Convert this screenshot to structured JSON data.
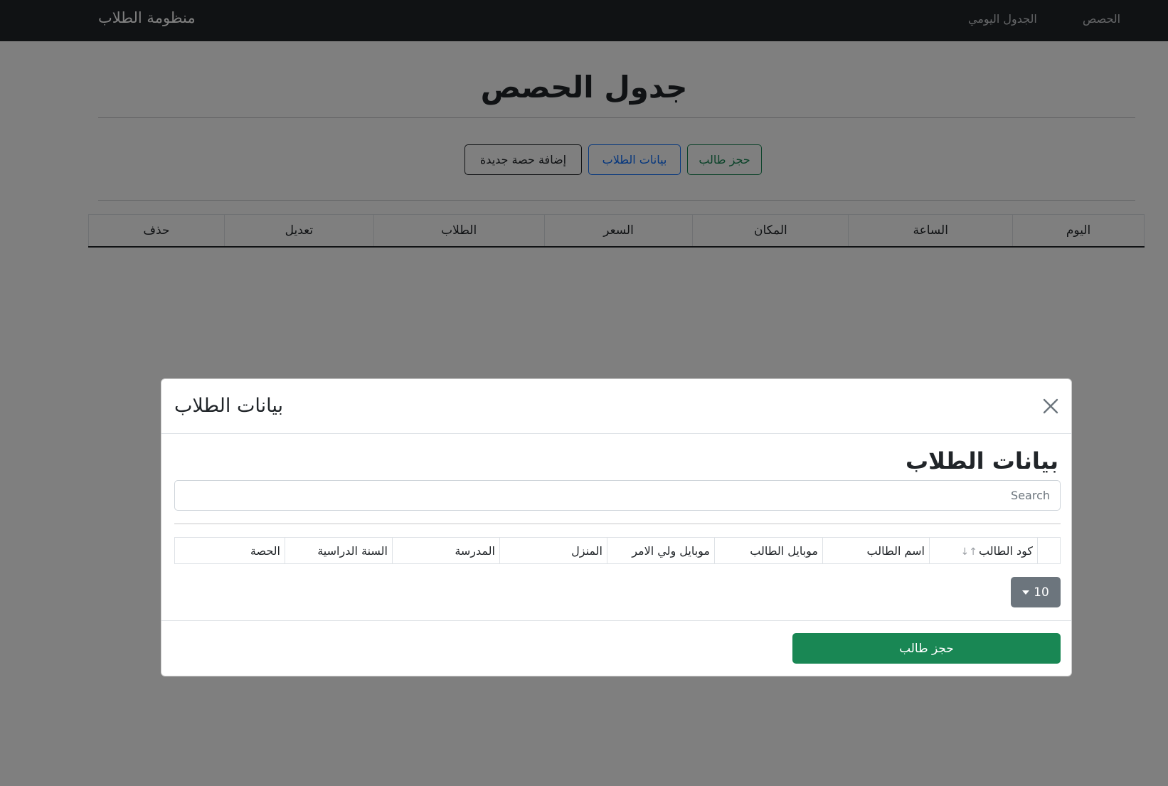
{
  "navbar": {
    "brand": "منظومة الطلاب",
    "links": [
      "الحصص",
      "الجدول اليومي"
    ]
  },
  "page": {
    "title": "جدول الحصص",
    "buttons": {
      "add_session": "إضافة حصة جديدة",
      "students_data": "بيانات الطلاب",
      "book_student": "حجز طالب"
    },
    "table_headers": [
      "اليوم",
      "الساعة",
      "المكان",
      "السعر",
      "الطلاب",
      "تعديل",
      "حذف"
    ]
  },
  "modal": {
    "title": "بيانات الطلاب",
    "body_title": "بيانات الطلاب",
    "search_placeholder": "Search",
    "sort_indicator": "↑↓",
    "table_headers": [
      "كود الطالب",
      "اسم الطالب",
      "موبايل الطالب",
      "موبايل ولي الامر",
      "المنزل",
      "المدرسة",
      "السنة الدراسية",
      "الحصة"
    ],
    "page_size": "10",
    "book_button": "حجز طالب"
  },
  "colors": {
    "navbar_bg": "#212529",
    "primary": "#0d6efd",
    "success": "#198754",
    "secondary": "#6c757d"
  }
}
